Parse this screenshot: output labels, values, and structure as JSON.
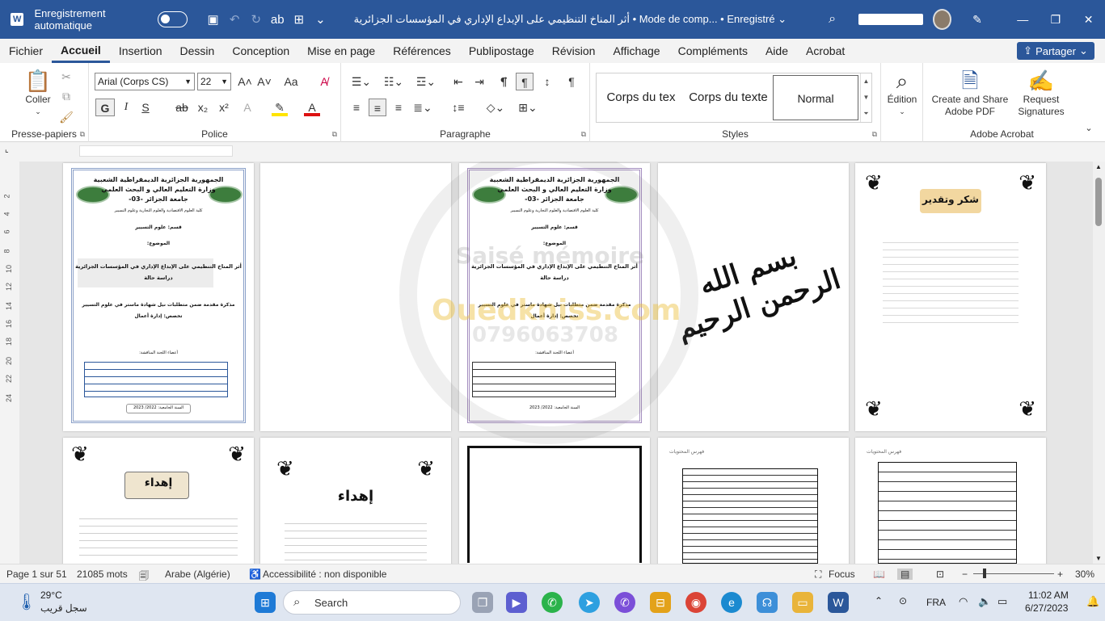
{
  "titlebar": {
    "autosave_label": "Enregistrement automatique",
    "doc_title": "أثر المناخ التنظيمي على الإبداع الإداري في المؤسسات الجزائرية  •  Mode de comp...  •  Enregistré ⌄",
    "icons": [
      "save-icon",
      "undo-icon",
      "redo-icon",
      "spelling-icon",
      "format-icon",
      "customize-icon"
    ]
  },
  "menu": {
    "items": [
      "Fichier",
      "Accueil",
      "Insertion",
      "Dessin",
      "Conception",
      "Mise en page",
      "Références",
      "Publipostage",
      "Révision",
      "Affichage",
      "Compléments",
      "Aide",
      "Acrobat"
    ],
    "share": "Partager"
  },
  "ribbon": {
    "clipboard": {
      "label": "Presse-papiers",
      "paste": "Coller"
    },
    "font": {
      "label": "Police",
      "font_name": "Arial (Corps CS)",
      "font_size": "22",
      "bold": "G",
      "italic": "I",
      "underline": "S",
      "strike": "ab",
      "sub": "x₂",
      "sup": "x²",
      "case": "Aa"
    },
    "paragraph": {
      "label": "Paragraphe"
    },
    "styles": {
      "label": "Styles",
      "items": [
        "Corps du tex",
        "Corps du texte",
        "Normal"
      ]
    },
    "editing": {
      "label": "Édition"
    },
    "acrobat": {
      "label": "Adobe Acrobat",
      "create_share": "Create and Share Adobe PDF",
      "request": "Request Signatures"
    }
  },
  "ruler": {
    "vertical_ticks": [
      "2",
      "4",
      "6",
      "8",
      "10",
      "12",
      "14",
      "16",
      "18",
      "20",
      "22",
      "24"
    ]
  },
  "pages": {
    "cover": {
      "line1": "الجمهورية الجزائرية الديمقراطية الشعبية",
      "line2": "وزارة التعليم العالي و البحث العلمي",
      "line3": "جامعة الجزائر -03-",
      "faculty": "كلية العلوم الاقتصادية والعلوم التجارية وعلوم التسيير",
      "dept": "قسم: علوم التسيير",
      "topic": "الموضوع:",
      "title": "أثر المناخ التنظيمي على الإبداع الإداري في المؤسسات الجزائرية",
      "case": "دراسة حالة",
      "memo": "مذكرة مقدمة ضمن متطلبات نيل شهادة ماستر في علوم التسيير",
      "spec": "تخصص: إدارة أعمال",
      "jury": "أعضاء اللجنة المناقشة:",
      "year": "السنة الجامعية: 2022/ 2023"
    },
    "basmala": "بسم الله الرحمن الرحيم",
    "thanks": "شكر وتقدير",
    "dedication": "إهداء",
    "toc_title": "فهرس المحتويات"
  },
  "watermark": {
    "line1": "Saisé mémoire",
    "line2": "Ouedkniss.com",
    "line3": "0796063708"
  },
  "status": {
    "page": "Page 1 sur 51",
    "words": "21085 mots",
    "language": "Arabe (Algérie)",
    "accessibility": "Accessibilité : non disponible",
    "focus": "Focus",
    "zoom": "30%"
  },
  "taskbar": {
    "temp": "29°C",
    "weather": "سجل قريب",
    "search": "Search",
    "lang": "FRA",
    "time": "11:02 AM",
    "date": "6/27/2023"
  }
}
